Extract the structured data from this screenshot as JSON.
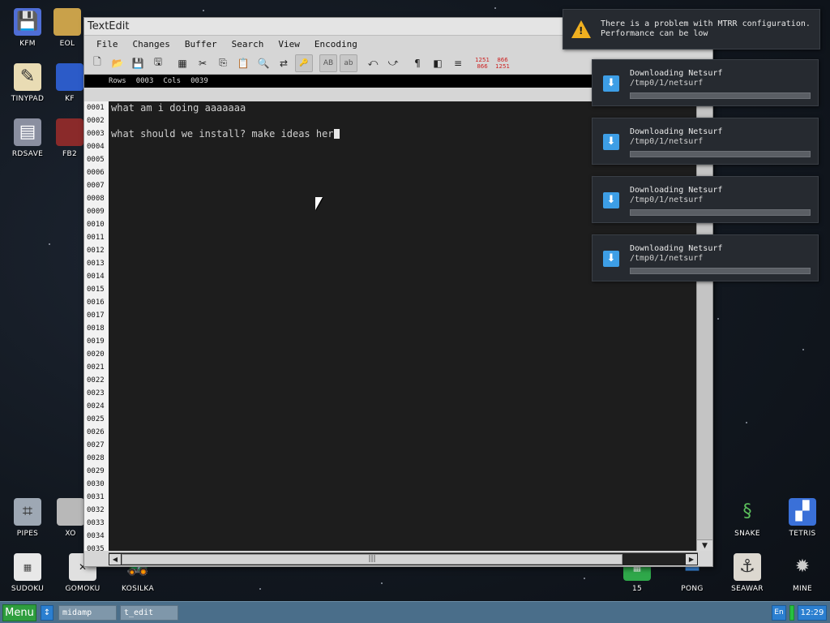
{
  "desktop": {
    "icons": [
      {
        "label": "KFM",
        "icon": "floppy-disk-icon"
      },
      {
        "label": "EOL",
        "icon": "folder-icon"
      },
      {
        "label": "TINYPAD",
        "icon": "notepad-icon"
      },
      {
        "label": "KF",
        "icon": "app-icon"
      },
      {
        "label": "RDSAVE",
        "icon": "save-icon"
      },
      {
        "label": "FB2",
        "icon": "book-icon"
      },
      {
        "label": "PIPES",
        "icon": "pipes-icon"
      },
      {
        "label": "XO",
        "icon": "game-icon"
      },
      {
        "label": "SUDOKU",
        "icon": "sudoku-icon"
      },
      {
        "label": "GOMOKU",
        "icon": "gomoku-icon"
      },
      {
        "label": "KOSILKA",
        "icon": "lawnmower-icon"
      },
      {
        "label": "15",
        "icon": "fifteen-puzzle-icon"
      },
      {
        "label": "PONG",
        "icon": "pong-icon"
      },
      {
        "label": "SEAWAR",
        "icon": "seawar-icon"
      },
      {
        "label": "MINE",
        "icon": "mine-icon"
      },
      {
        "label": "SNAKE",
        "icon": "snake-icon"
      },
      {
        "label": "TETRIS",
        "icon": "tetris-icon"
      }
    ]
  },
  "window": {
    "title": "TextEdit",
    "menu": [
      "File",
      "Changes",
      "Buffer",
      "Search",
      "View",
      "Encoding"
    ],
    "toolbar": {
      "ab_upper": "AB",
      "ab_lower": "ab",
      "pilcrow": "¶",
      "enc1_top": "1251",
      "enc1_bot": "866",
      "enc2_top": "866",
      "enc2_bot": "1251"
    },
    "info": {
      "rows_label": "Rows",
      "rows_value": "0003",
      "cols_label": "Cols",
      "cols_value": "0039"
    },
    "line_numbers": [
      "0001",
      "0002",
      "0003",
      "0004",
      "0005",
      "0006",
      "0007",
      "0008",
      "0009",
      "0010",
      "0011",
      "0012",
      "0013",
      "0014",
      "0015",
      "0016",
      "0017",
      "0018",
      "0019",
      "0020",
      "0021",
      "0022",
      "0023",
      "0024",
      "0025",
      "0026",
      "0027",
      "0028",
      "0029",
      "0030",
      "0031",
      "0032",
      "0033",
      "0034",
      "0035"
    ],
    "lines": {
      "l1": "what am i doing aaaaaaa",
      "l3": "what should we install? make ideas her"
    },
    "hscroll_grip": "|||"
  },
  "notifications": {
    "warning": {
      "message_line1": "There is a problem with MTRR configuration.",
      "message_line2": "Performance can be low",
      "icon": "warning-icon",
      "color": "#f0b020"
    },
    "downloads": [
      {
        "title": "Downloading Netsurf",
        "path": "/tmp0/1/netsurf",
        "progress": 0.0
      },
      {
        "title": "Downloading Netsurf",
        "path": "/tmp0/1/netsurf",
        "progress": 0.0
      },
      {
        "title": "Downloading Netsurf",
        "path": "/tmp0/1/netsurf",
        "progress": 0.0
      },
      {
        "title": "Downloading Netsurf",
        "path": "/tmp0/1/netsurf",
        "progress": 0.0
      }
    ]
  },
  "taskbar": {
    "menu_label": "Menu",
    "swap_icon": "↕",
    "tasks": [
      "midamp",
      "t_edit"
    ],
    "lang": "En",
    "clock": "12:29",
    "accent": "#2b7fd0"
  }
}
